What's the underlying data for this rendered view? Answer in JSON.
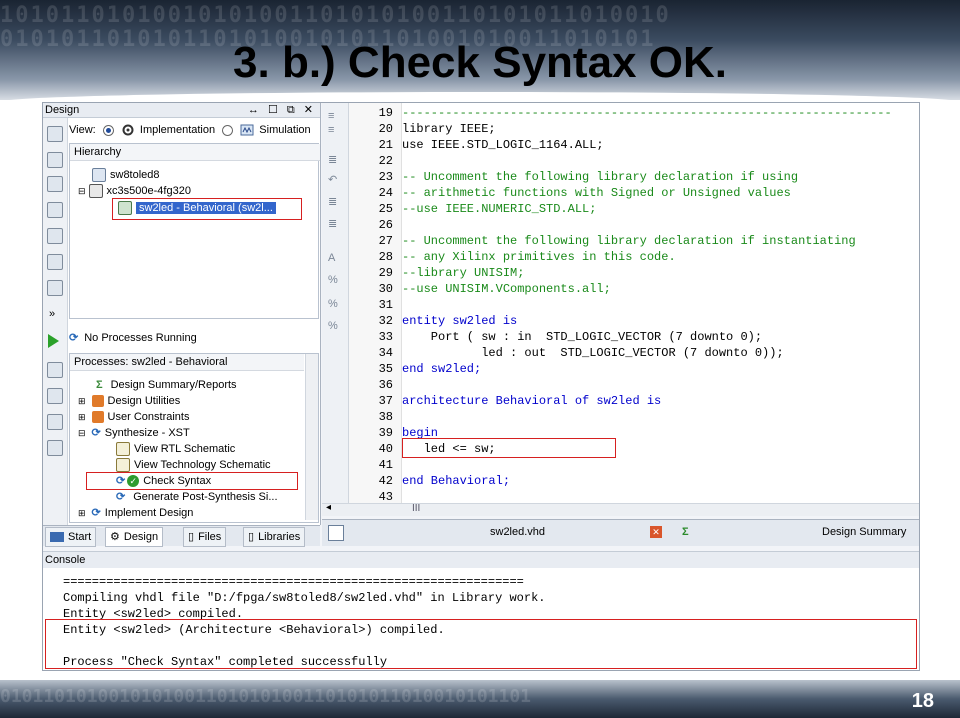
{
  "slide": {
    "title": "3. b.) Check Syntax OK.",
    "page_number": "18"
  },
  "design_panel": {
    "title": "Design",
    "controls": "↔ ☐ ⧉ ✕",
    "view_label": "View:",
    "view_options": [
      "Implementation",
      "Simulation"
    ],
    "hierarchy_label": "Hierarchy",
    "tree": [
      "sw8toled8",
      "xc3s500e-4fg320",
      "sw2led - Behavioral (sw2l..."
    ],
    "processes_status": "No Processes Running",
    "processes_label": "Processes: sw2led - Behavioral",
    "processes": [
      "Design Summary/Reports",
      "Design Utilities",
      "User Constraints",
      "Synthesize - XST",
      "View RTL Schematic",
      "View Technology Schematic",
      "Check Syntax",
      "Generate Post-Synthesis Si...",
      "Implement Design"
    ],
    "tabs": [
      "Start",
      "Design",
      "Files",
      "Libraries"
    ]
  },
  "editor": {
    "lines": [
      {
        "n": "19",
        "t": "--------------------------------------------------------------------"
      },
      {
        "n": "20",
        "t": "library IEEE;"
      },
      {
        "n": "21",
        "t": "use IEEE.STD_LOGIC_1164.ALL;"
      },
      {
        "n": "22",
        "t": ""
      },
      {
        "n": "23",
        "t": "-- Uncomment the following library declaration if using"
      },
      {
        "n": "24",
        "t": "-- arithmetic functions with Signed or Unsigned values"
      },
      {
        "n": "25",
        "t": "--use IEEE.NUMERIC_STD.ALL;"
      },
      {
        "n": "26",
        "t": ""
      },
      {
        "n": "27",
        "t": "-- Uncomment the following library declaration if instantiating"
      },
      {
        "n": "28",
        "t": "-- any Xilinx primitives in this code."
      },
      {
        "n": "29",
        "t": "--library UNISIM;"
      },
      {
        "n": "30",
        "t": "--use UNISIM.VComponents.all;"
      },
      {
        "n": "31",
        "t": ""
      },
      {
        "n": "32",
        "t": "entity sw2led is"
      },
      {
        "n": "33",
        "t": "    Port ( sw : in  STD_LOGIC_VECTOR (7 downto 0);"
      },
      {
        "n": "34",
        "t": "           led : out  STD_LOGIC_VECTOR (7 downto 0));"
      },
      {
        "n": "35",
        "t": "end sw2led;"
      },
      {
        "n": "36",
        "t": ""
      },
      {
        "n": "37",
        "t": "architecture Behavioral of sw2led is"
      },
      {
        "n": "38",
        "t": ""
      },
      {
        "n": "39",
        "t": "begin"
      },
      {
        "n": "40",
        "t": "   led <= sw;"
      },
      {
        "n": "41",
        "t": ""
      },
      {
        "n": "42",
        "t": "end Behavioral;"
      },
      {
        "n": "43",
        "t": ""
      }
    ],
    "scroll_marker": "III",
    "tab_file": "sw2led.vhd",
    "tab_summary": "Design Summary"
  },
  "console": {
    "title": "Console",
    "lines": [
      "================================================================",
      "Compiling vhdl file \"D:/fpga/sw8toled8/sw2led.vhd\" in Library work.",
      "Entity <sw2led> compiled.",
      "Entity <sw2led> (Architecture <Behavioral>) compiled.",
      "",
      "Process \"Check Syntax\" completed successfully"
    ]
  }
}
